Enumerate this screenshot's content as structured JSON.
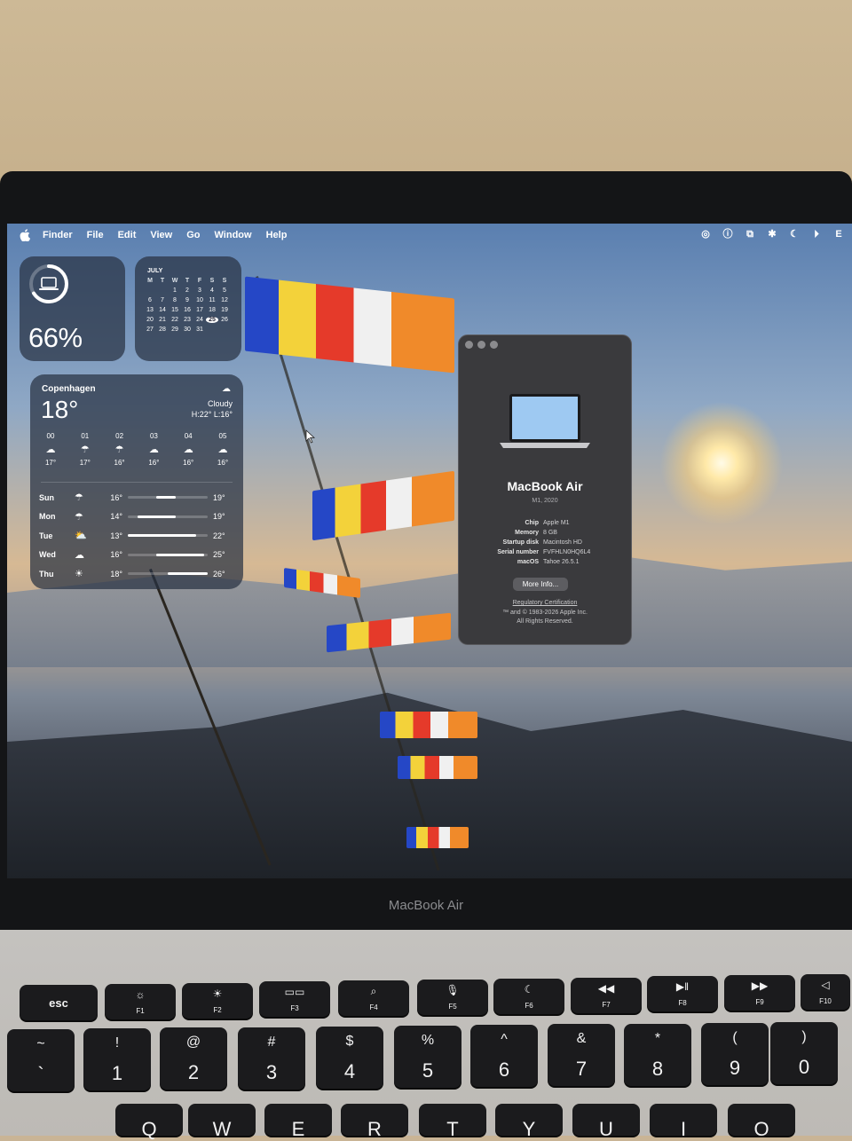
{
  "menubar": {
    "app": "Finder",
    "items": [
      "File",
      "Edit",
      "View",
      "Go",
      "Window",
      "Help"
    ],
    "status_icons": [
      "screen-mirroring-icon",
      "a11y-icon",
      "stage-manager-icon",
      "bluetooth-icon",
      "focus-moon-icon",
      "play-icon",
      "input-source-icon"
    ]
  },
  "battery_widget": {
    "percent": "66%",
    "level": 0.66
  },
  "calendar_widget": {
    "month": "JULY",
    "weekdays": [
      "M",
      "T",
      "W",
      "T",
      "F",
      "S",
      "S"
    ],
    "weeks": [
      [
        "",
        "",
        "1",
        "2",
        "3",
        "4",
        "5"
      ],
      [
        "6",
        "7",
        "8",
        "9",
        "10",
        "11",
        "12"
      ],
      [
        "13",
        "14",
        "15",
        "16",
        "17",
        "18",
        "19"
      ],
      [
        "20",
        "21",
        "22",
        "23",
        "24",
        "25",
        "26"
      ],
      [
        "27",
        "28",
        "29",
        "30",
        "31",
        "",
        ""
      ]
    ],
    "today": "25"
  },
  "weather_widget": {
    "city": "Copenhagen",
    "temp": "18°",
    "condition": "Cloudy",
    "hilo": "H:22° L:16°",
    "hourly": [
      {
        "hour": "00",
        "icon": "cloud-icon",
        "temp": "17°"
      },
      {
        "hour": "01",
        "icon": "rain-icon",
        "temp": "17°"
      },
      {
        "hour": "02",
        "icon": "sun-rain-icon",
        "temp": "16°"
      },
      {
        "hour": "03",
        "icon": "cloud-icon",
        "temp": "16°"
      },
      {
        "hour": "04",
        "icon": "cloud-icon",
        "temp": "16°"
      },
      {
        "hour": "05",
        "icon": "cloud-icon",
        "temp": "16°"
      }
    ],
    "daily": [
      {
        "day": "Sun",
        "icon": "rain-icon",
        "low": "16°",
        "high": "19°",
        "range": [
          0.35,
          0.6
        ]
      },
      {
        "day": "Mon",
        "icon": "rain-icon",
        "low": "14°",
        "high": "19°",
        "range": [
          0.12,
          0.6
        ]
      },
      {
        "day": "Tue",
        "icon": "partly-sunny-icon",
        "low": "13°",
        "high": "22°",
        "range": [
          0.0,
          0.85
        ]
      },
      {
        "day": "Wed",
        "icon": "cloud-icon",
        "low": "16°",
        "high": "25°",
        "range": [
          0.35,
          0.95
        ]
      },
      {
        "day": "Thu",
        "icon": "sun-icon",
        "low": "18°",
        "high": "26°",
        "range": [
          0.5,
          1.0
        ]
      }
    ]
  },
  "about_window": {
    "model": "MacBook Air",
    "year": "M1, 2020",
    "specs": [
      {
        "key": "Chip",
        "value": "Apple M1"
      },
      {
        "key": "Memory",
        "value": "8 GB"
      },
      {
        "key": "Startup disk",
        "value": "Macintosh HD"
      },
      {
        "key": "Serial number",
        "value": "FVFHLN0HQ6L4"
      },
      {
        "key": "macOS",
        "value": "Tahoe 26.5.1"
      }
    ],
    "more_info": "More Info...",
    "regulatory": "Regulatory Certification",
    "copyright": "™ and © 1983-2026 Apple Inc.",
    "rights": "All Rights Reserved."
  },
  "chin_label": "MacBook Air",
  "keyboard": {
    "fn_row": [
      {
        "label": "esc",
        "icon": ""
      },
      {
        "label": "F1",
        "icon": "☼"
      },
      {
        "label": "F2",
        "icon": "☀"
      },
      {
        "label": "F3",
        "icon": "▭▭"
      },
      {
        "label": "F4",
        "icon": "⌕"
      },
      {
        "label": "F5",
        "icon": "🎙"
      },
      {
        "label": "F6",
        "icon": "☾"
      },
      {
        "label": "F7",
        "icon": "◀◀"
      },
      {
        "label": "F8",
        "icon": "▶‖"
      },
      {
        "label": "F9",
        "icon": "▶▶"
      },
      {
        "label": "F10",
        "icon": "◁"
      }
    ],
    "num_row": [
      {
        "top": "~",
        "bottom": "`"
      },
      {
        "top": "!",
        "bottom": "1"
      },
      {
        "top": "@",
        "bottom": "2"
      },
      {
        "top": "#",
        "bottom": "3"
      },
      {
        "top": "$",
        "bottom": "4"
      },
      {
        "top": "%",
        "bottom": "5"
      },
      {
        "top": "^",
        "bottom": "6"
      },
      {
        "top": "&",
        "bottom": "7"
      },
      {
        "top": "*",
        "bottom": "8"
      },
      {
        "top": "(",
        "bottom": "9"
      },
      {
        "top": ")",
        "bottom": "0"
      }
    ],
    "letter_row": [
      "Q",
      "W",
      "E",
      "R",
      "T",
      "Y",
      "U",
      "I",
      "O"
    ]
  }
}
